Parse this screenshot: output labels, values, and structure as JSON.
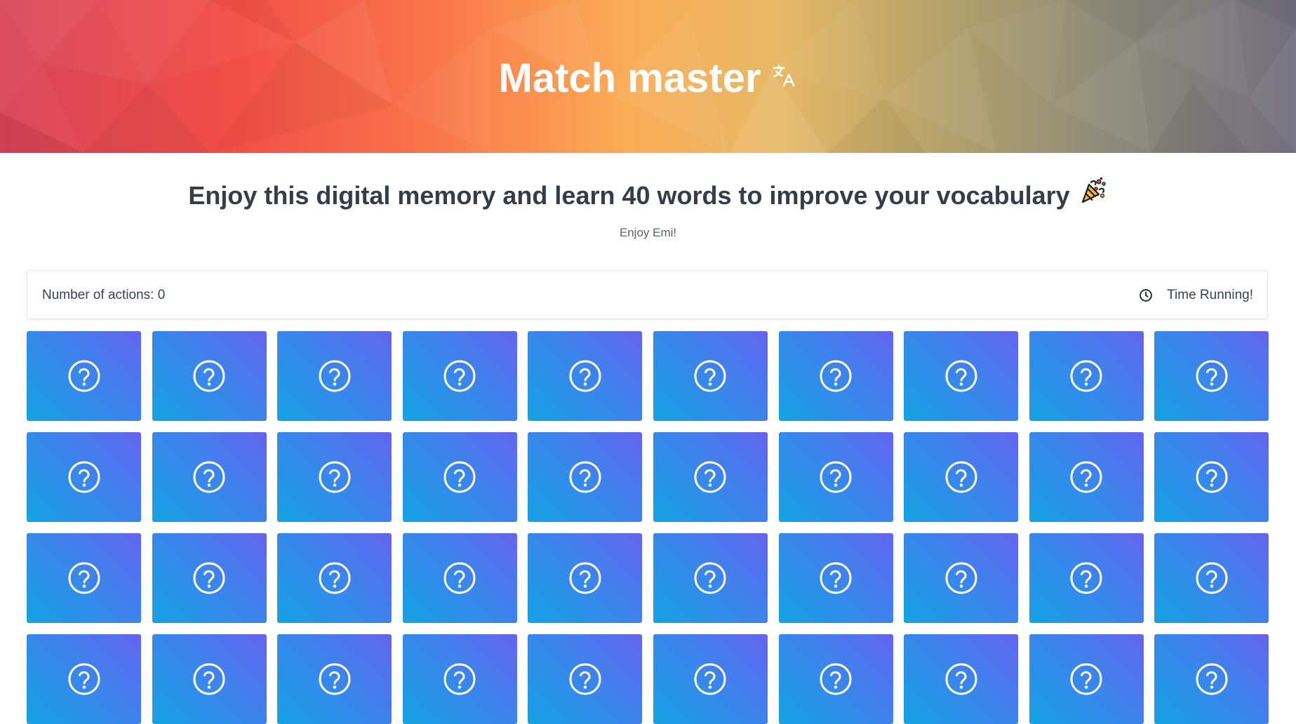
{
  "header": {
    "title": "Match master",
    "title_icon": "translate-icon"
  },
  "intro": {
    "heading": "Enjoy this digital memory and learn 40 words to improve your vocabulary",
    "heading_icon": "party-popper-icon",
    "byline": "Enjoy Emi!"
  },
  "status": {
    "actions_text": "Number of actions: 0",
    "timer_icon": "clock-icon",
    "timer_text": "Time Running!"
  },
  "board": {
    "columns": 10,
    "card_count": 40,
    "card_icon": "question-circle-icon",
    "card_colors": [
      "#14a3e3",
      "#6464ee"
    ]
  }
}
